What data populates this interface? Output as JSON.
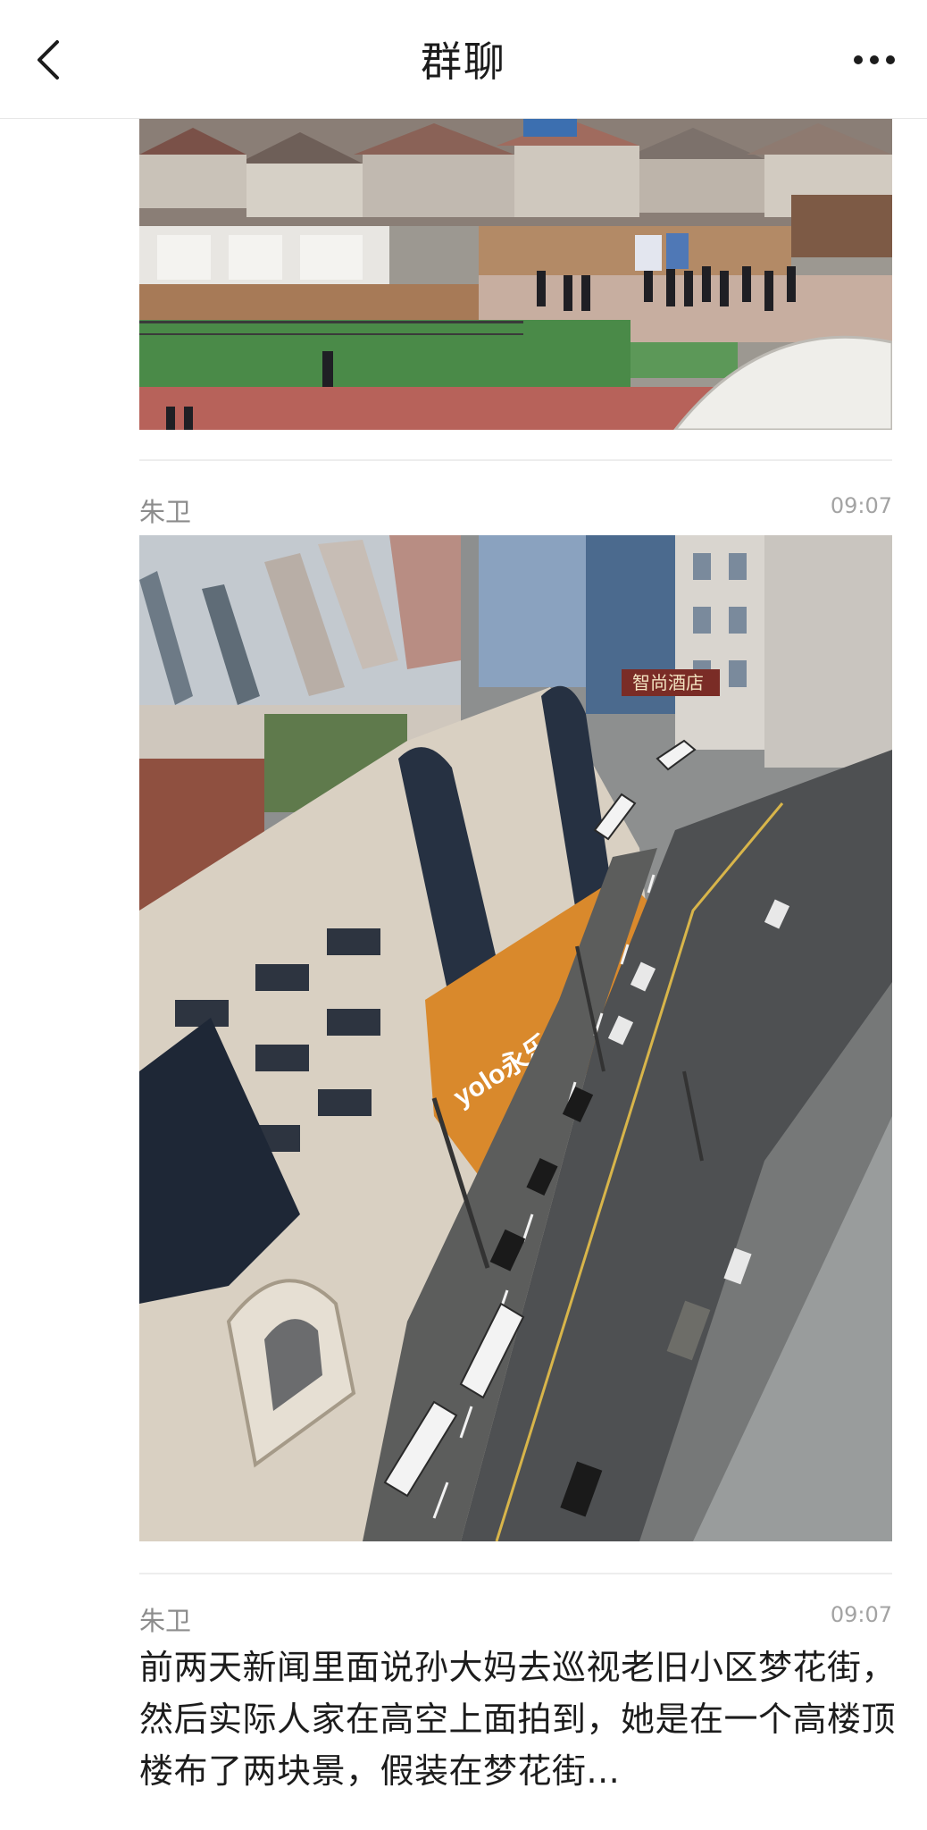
{
  "header": {
    "title": "群聊",
    "back_icon": "chevron-left-icon",
    "more_icon": "ellipsis-icon"
  },
  "messages": [
    {
      "type": "image",
      "description": "rooftop photo (partially scrolled out of view)"
    },
    {
      "type": "image",
      "sender": "朱卫",
      "time": "09:07",
      "image_signage": [
        "yolo永乐",
        "智尚酒店"
      ]
    },
    {
      "type": "text",
      "sender": "朱卫",
      "time": "09:07",
      "text": "前两天新闻里面说孙大妈去巡视老旧小区梦花街，然后实际人家在高空上面拍到，她是在一个高楼顶楼布了两块景，假装在梦花街..."
    }
  ],
  "colors": {
    "accent_orange": "#d9892c",
    "divider": "#ededed",
    "meta_text": "#8c8c8c"
  }
}
